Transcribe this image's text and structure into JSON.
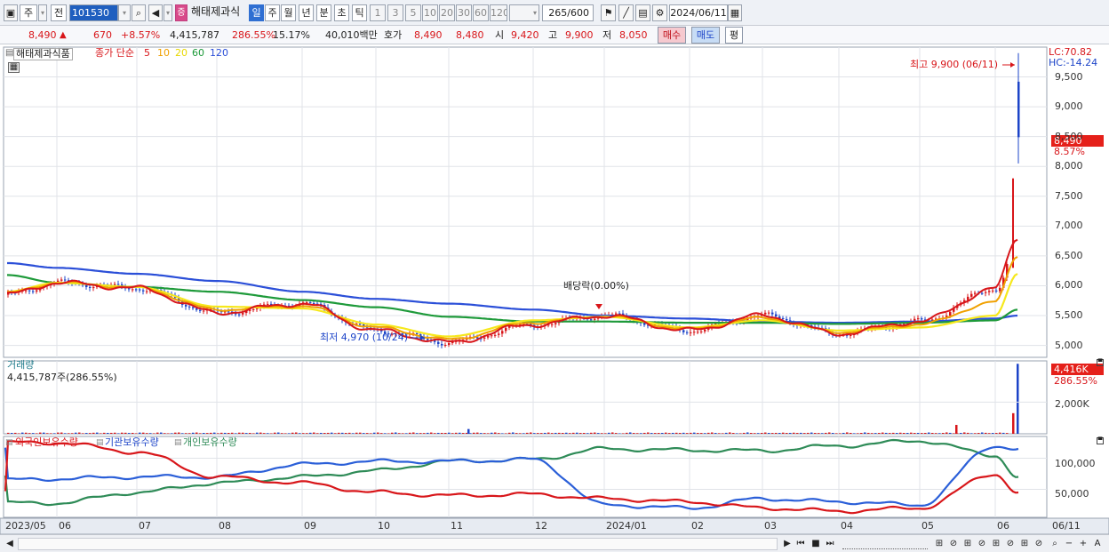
{
  "toolbar": {
    "market": "주",
    "prev": "전",
    "code": "101530",
    "stock_name": "해태제과식",
    "periods": [
      "일",
      "주",
      "월",
      "년",
      "분",
      "초",
      "틱"
    ],
    "ticks": [
      "1",
      "3",
      "5",
      "10",
      "20",
      "30",
      "60",
      "120"
    ],
    "count": "265",
    "total": "/600",
    "date": "2024/06/11"
  },
  "pricebar": {
    "price": "8,490",
    "change": "670",
    "change_pct": "+8.57%",
    "volume": "4,415,787",
    "vol_ratio": "286.55%",
    "turnover": "15.17%",
    "amount": "40,010백만",
    "quote_label": "호가",
    "ask": "8,490",
    "bid": "8,480",
    "open_label": "시",
    "open": "9,420",
    "high_label": "고",
    "high": "9,900",
    "low_label": "저",
    "low": "8,050",
    "buy": "매수",
    "sell": "매도",
    "avg": "평"
  },
  "legend": {
    "stock": "해태제과식품",
    "ma_prefix": "종가 단순",
    "ma": [
      "5",
      "10",
      "20",
      "60",
      "120"
    ],
    "volume_title": "거래량",
    "volume_value": "4,415,787주(286.55%)",
    "holders": [
      "외국인보유수량",
      "기관보유수량",
      "개인보유수량"
    ]
  },
  "annotations": {
    "high": "최고 9,900 (06/11)",
    "low": "최저 4,970 (10/24)",
    "dividend": "배당락(0.00%)",
    "lc": "LC:70.82",
    "hc": "HC:-14.24",
    "last_price": "8,490",
    "last_pct": "8.57%",
    "vol_last": "4,416K",
    "vol_pct": "286.55%"
  },
  "colors": {
    "ma5": "#d8161a",
    "ma10": "#f0a000",
    "ma20": "#f6e81c",
    "ma60": "#1e9a3a",
    "ma120": "#2b4fd8",
    "up": "#d8161a",
    "down": "#1d44c8",
    "foreign": "#d8161a",
    "institution": "#2b5fd8",
    "individual": "#2e8b57"
  },
  "chart_data": {
    "type": "line",
    "x_labels": [
      "2023/05",
      "06",
      "07",
      "08",
      "09",
      "10",
      "11",
      "12",
      "2024/01",
      "02",
      "03",
      "04",
      "05",
      "06",
      "06/11"
    ],
    "price_ticks": [
      "9,500",
      "9,000",
      "8,500",
      "8,000",
      "7,500",
      "7,000",
      "6,500",
      "6,000",
      "5,500",
      "5,000"
    ],
    "volume_ticks": [
      "2,000K"
    ],
    "holder_ticks": [
      "100,000",
      "50,000"
    ],
    "ylim_price": [
      4800,
      10000
    ],
    "months": [
      "2023/05",
      "06",
      "07",
      "08",
      "09",
      "10",
      "11",
      "12",
      "2024/01",
      "02",
      "03",
      "04",
      "05",
      "06"
    ],
    "ma120": [
      6380,
      6300,
      6200,
      6080,
      5900,
      5780,
      5700,
      5600,
      5500,
      5450,
      5400,
      5380,
      5400,
      5450,
      5500
    ],
    "ma60": [
      6180,
      6050,
      5980,
      5900,
      5760,
      5640,
      5480,
      5400,
      5400,
      5380,
      5380,
      5360,
      5380,
      5420,
      5600
    ],
    "ma20": [
      5900,
      6050,
      5980,
      5650,
      5620,
      5350,
      5150,
      5420,
      5480,
      5300,
      5420,
      5250,
      5300,
      5500,
      6200
    ],
    "ma5": [
      5850,
      6050,
      5960,
      5550,
      5700,
      5250,
      5050,
      5350,
      5500,
      5250,
      5500,
      5200,
      5400,
      5950,
      6800
    ],
    "last_high": 9900,
    "last_low": 8050,
    "last_close": 8490,
    "holders_foreign": [
      125000,
      125000,
      110000,
      70000,
      60000,
      45000,
      40000,
      42000,
      35000,
      30000,
      20000,
      15000,
      20000,
      75000,
      45000
    ],
    "holders_institution": [
      65000,
      67000,
      70000,
      70000,
      90000,
      95000,
      95000,
      98000,
      25000,
      20000,
      35000,
      30000,
      25000,
      120000,
      115000
    ],
    "holders_individual": [
      28000,
      28000,
      45000,
      60000,
      70000,
      80000,
      95000,
      98000,
      115000,
      113000,
      112000,
      120000,
      128000,
      105000,
      70000
    ]
  }
}
